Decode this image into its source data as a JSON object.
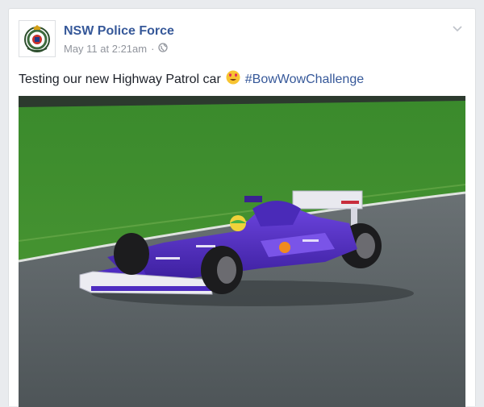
{
  "post": {
    "page_name": "NSW Police Force",
    "timestamp": "May 11 at 2:21am",
    "separator": "·",
    "privacy_icon": "globe-icon",
    "options_icon": "chevron-down-icon",
    "message_text": "Testing our new Highway Patrol car",
    "emoji": "heart-eyes-emoji",
    "hashtag": "#BowWowChallenge",
    "photo_subject": "purple formula one race car on track"
  },
  "colors": {
    "link": "#365899",
    "meta": "#90949c",
    "text": "#1d2129",
    "car_purple": "#5a2fc8",
    "grass": "#3f8a2e",
    "track": "#5b6366"
  }
}
